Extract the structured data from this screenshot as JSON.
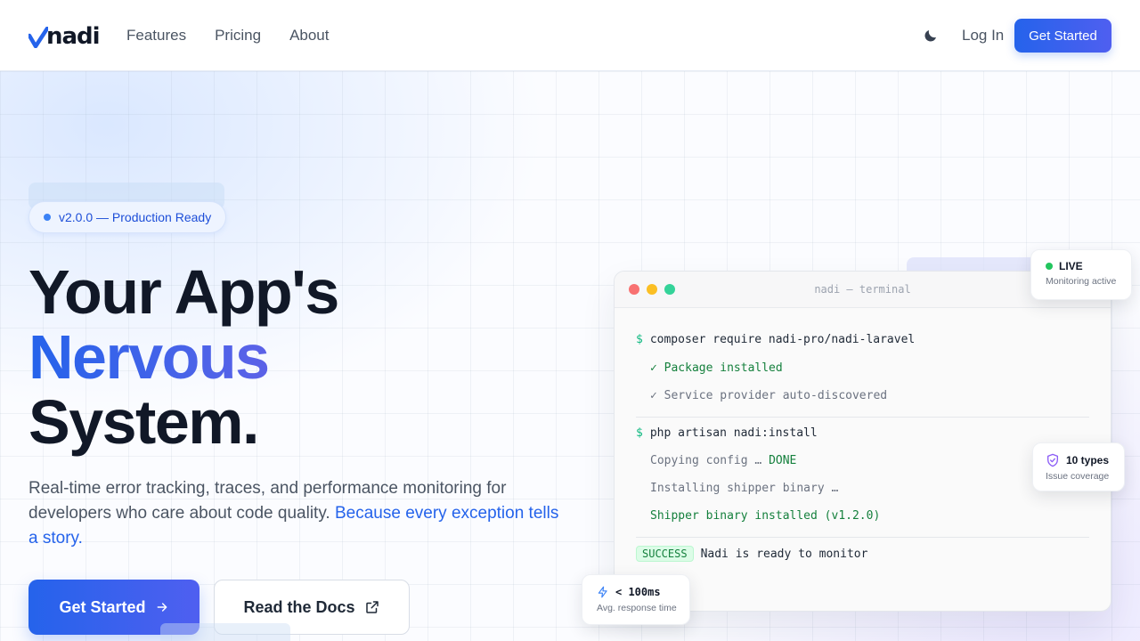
{
  "brand": {
    "name": "nadi",
    "accent": "#2563eb"
  },
  "nav": {
    "links": [
      "Features",
      "Pricing",
      "About"
    ],
    "login_label": "Log In",
    "cta_label": "Get Started"
  },
  "hero": {
    "badge": "v2.0.0 — Production Ready",
    "headline_line1": "Your App's",
    "headline_line2": "Nervous",
    "headline_line3": "System.",
    "subtitle": "Real-time error tracking, traces, and performance monitoring for developers who care about code quality.",
    "subtitle_highlight": "Because every exception tells a story.",
    "primary_cta": "Get Started",
    "secondary_cta": "Read the Docs"
  },
  "terminal": {
    "title": "nadi — terminal",
    "prompt_symbol": "$",
    "cmd1": "composer require nadi-pro/nadi-laravel",
    "out1": "✓ Package installed",
    "out2": "✓ Service provider auto-discovered",
    "cmd2": "php artisan nadi:install",
    "out3_prefix": "Copying config … ",
    "out3_status": "DONE",
    "out4": "Installing shipper binary …",
    "out5": "Shipper binary installed (v1.2.0)",
    "success_tag": "SUCCESS",
    "success_text": "Nadi is ready to monitor"
  },
  "cards": {
    "live": {
      "title": "LIVE",
      "subtitle": "Monitoring active"
    },
    "types": {
      "title": "10 types",
      "subtitle": "Issue coverage"
    },
    "speed": {
      "title": "< 100ms",
      "subtitle": "Avg. response time"
    }
  },
  "icons": {
    "theme_toggle": "moon-icon",
    "primary_cta": "arrow-right-icon",
    "secondary_cta": "external-link-icon",
    "types_card": "shield-check-icon",
    "speed_card": "lightning-icon"
  }
}
